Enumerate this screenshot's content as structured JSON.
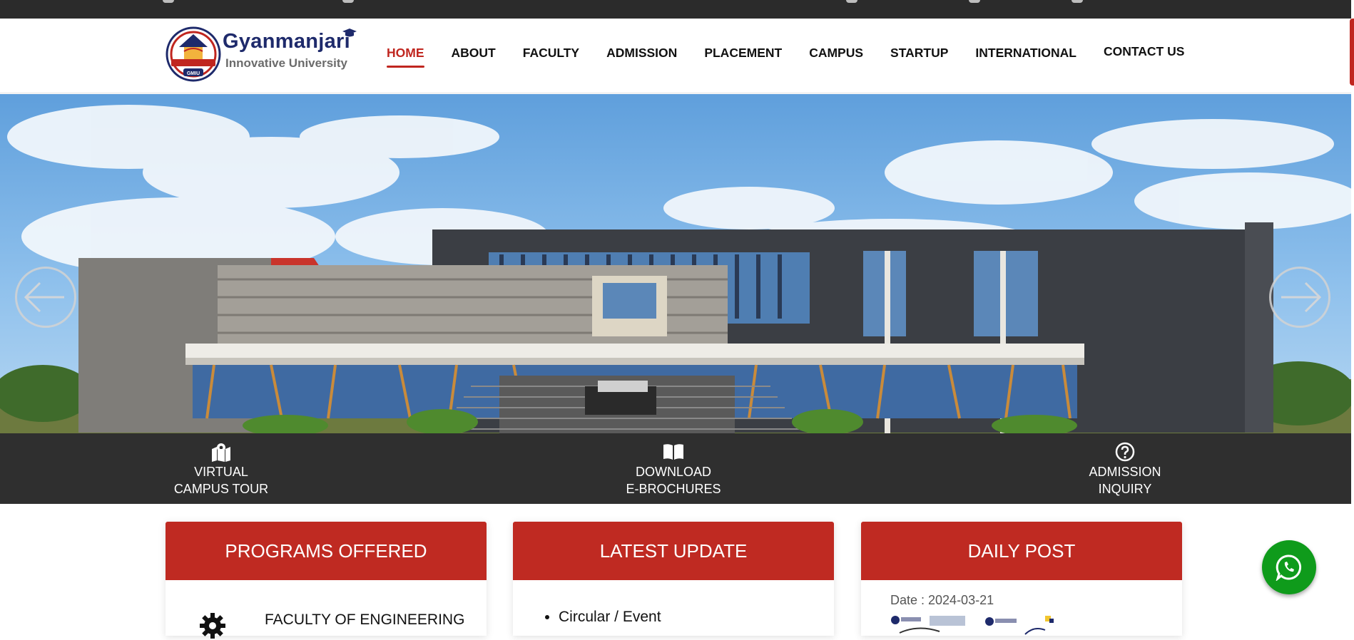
{
  "brand": {
    "name": "Gyanmanjari",
    "subtitle": "Innovative University",
    "emblem_text": "GMIU",
    "colors": {
      "primary_red": "#c0261f",
      "navy": "#1e2a6b",
      "dark_strip": "#2f2f2f",
      "whatsapp": "#0f9b1b"
    }
  },
  "nav": {
    "items": [
      {
        "label": "HOME",
        "active": true
      },
      {
        "label": "ABOUT"
      },
      {
        "label": "FACULTY"
      },
      {
        "label": "ADMISSION"
      },
      {
        "label": "PLACEMENT"
      },
      {
        "label": "CAMPUS"
      },
      {
        "label": "STARTUP"
      },
      {
        "label": "INTERNATIONAL"
      },
      {
        "label": "CONTACT US"
      }
    ]
  },
  "hero": {
    "prev_icon": "arrow-left-icon",
    "next_icon": "arrow-right-icon"
  },
  "quick_links": [
    {
      "line1": "VIRTUAL",
      "line2": "CAMPUS TOUR",
      "icon": "map-pin-icon"
    },
    {
      "line1": "DOWNLOAD",
      "line2": "E-BROCHURES",
      "icon": "open-book-icon"
    },
    {
      "line1": "ADMISSION",
      "line2": "INQUIRY",
      "icon": "question-circle-icon"
    }
  ],
  "cards": {
    "programs": {
      "title": "PROGRAMS OFFERED",
      "first_item": "FACULTY OF ENGINEERING",
      "icon": "gear-icon"
    },
    "updates": {
      "title": "LATEST UPDATE",
      "items": [
        "Circular / Event"
      ]
    },
    "daily_post": {
      "title": "DAILY POST",
      "date": "Date : 2024-03-21"
    }
  },
  "whatsapp": {
    "icon": "whatsapp-icon"
  }
}
